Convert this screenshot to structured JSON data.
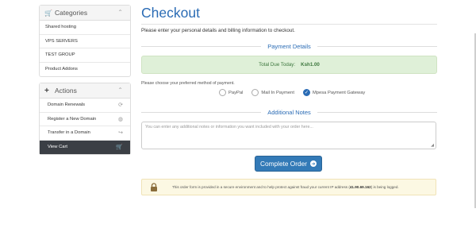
{
  "sidebar": {
    "categories": {
      "title": "Categories",
      "icon": "cart-icon",
      "items": [
        {
          "label": "Shared hosting"
        },
        {
          "label": "VPS SERVERS"
        },
        {
          "label": "TEST GROUP"
        },
        {
          "label": "Product Addons"
        }
      ]
    },
    "actions": {
      "title": "Actions",
      "icon": "plus-icon",
      "items": [
        {
          "label": "Domain Renewals",
          "icon": "refresh-icon"
        },
        {
          "label": "Register a New Domain",
          "icon": "globe-icon"
        },
        {
          "label": "Transfer in a Domain",
          "icon": "share-icon"
        },
        {
          "label": "View Cart",
          "icon": "cart-icon",
          "active": true
        }
      ]
    }
  },
  "main": {
    "title": "Checkout",
    "intro": "Please enter your personal details and billing information to checkout.",
    "payment_details_heading": "Payment Details",
    "total_due_label": "Total Due Today:",
    "total_due_value": "Ksh1.00",
    "choose_method": "Please choose your preferred method of payment.",
    "payment_options": [
      {
        "label": "PayPal",
        "selected": false
      },
      {
        "label": "Mail In Payment",
        "selected": false
      },
      {
        "label": "Mpesa Payment Gateway",
        "selected": true
      }
    ],
    "notes_heading": "Additional Notes",
    "notes_placeholder": "You can enter any additional notes or information you want included with your order here...",
    "complete_button": "Complete Order",
    "secure_text_before": "This order form is provided in a secure environment and to help protect against fraud your current IP address (",
    "secure_ip": "41.90.69.162",
    "secure_text_after": ") is being logged."
  },
  "colors": {
    "accent": "#2b6cb5",
    "success_bg": "#dff0d8",
    "warning_bg": "#fcf8e3",
    "active_nav": "#3b3f45",
    "button": "#337ab7"
  }
}
